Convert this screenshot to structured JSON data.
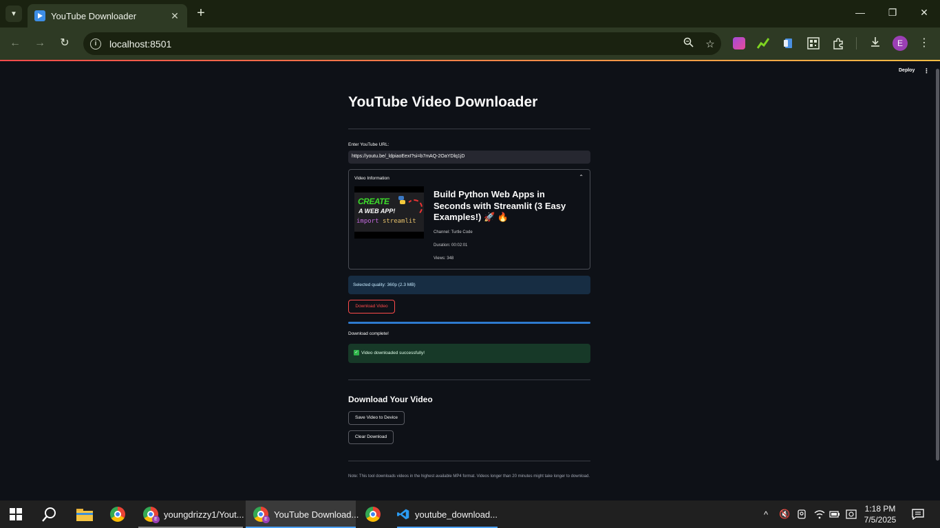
{
  "browser": {
    "tab_title": "YouTube Downloader",
    "tab_close": "✕",
    "new_tab": "+",
    "url": "localhost:8501",
    "profile_initial": "E"
  },
  "app": {
    "deploy_label": "Deploy",
    "title": "YouTube Video Downloader",
    "url_label": "Enter YouTube URL:",
    "url_value": "https://youtu.be/_ldpiaoEexI?si=b7mAQ-2OaYDlq1jD",
    "expander_title": "Video Information",
    "thumbnail": {
      "line1": "CREATE",
      "line2": "A WEB APP!",
      "code_import": "import",
      "code_module": "streamlit"
    },
    "video_title": "Build Python Web Apps in Seconds with Streamlit (3 Easy Examples!) 🚀 🔥",
    "channel": "Channel: Turtle Code",
    "duration": "Duration: 00:02:01",
    "views": "Views: 348",
    "selected_quality": "Selected quality: 360p (2.3 MB)",
    "download_button": "Download Video",
    "progress": 1.0,
    "download_status": "Download complete!",
    "success_message": "Video downloaded successfully!",
    "section_title": "Download Your Video",
    "save_button": "Save Video to Device",
    "clear_button": "Clear Download",
    "note": "Note: This tool downloads videos in the highest available MP4 format. Videos longer than 20 minutes might take longer to download."
  },
  "taskbar": {
    "items": [
      {
        "label": "youngdrizzy1/Yout..."
      },
      {
        "label": "YouTube Download..."
      },
      {
        "label": "youtube_download..."
      }
    ],
    "time": "1:18 PM",
    "date": "7/5/2025"
  },
  "colors": {
    "accent_red": "#ff4b4b",
    "progress_blue": "#2e7bcf",
    "app_background": "#0e1117"
  }
}
